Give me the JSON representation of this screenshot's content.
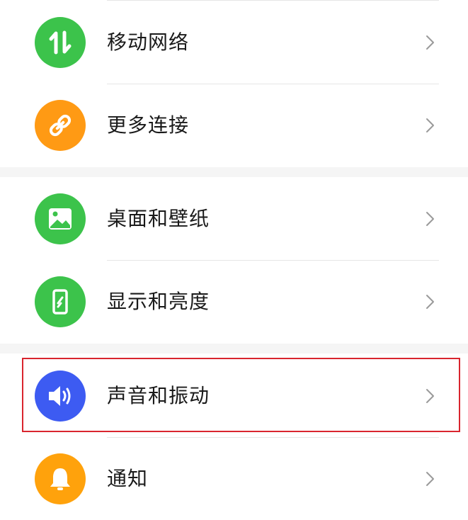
{
  "colors": {
    "green": "#3cc34b",
    "orange": "#ff9a14",
    "blue": "#3d5bf2",
    "amber": "#ffa20c",
    "highlight": "#d9252e"
  },
  "groups": [
    {
      "items": [
        {
          "label": "移动网络",
          "icon": "mobile-data-arrows-icon",
          "color": "#3cc34b"
        },
        {
          "label": "更多连接",
          "icon": "link-icon",
          "color": "#ff9a14"
        }
      ]
    },
    {
      "items": [
        {
          "label": "桌面和壁纸",
          "icon": "wallpaper-image-icon",
          "color": "#3cc34b"
        },
        {
          "label": "显示和亮度",
          "icon": "phone-display-icon",
          "color": "#3cc34b"
        }
      ]
    },
    {
      "items": [
        {
          "label": "声音和振动",
          "icon": "speaker-icon",
          "color": "#3d5bf2",
          "highlighted": true
        },
        {
          "label": "通知",
          "icon": "bell-icon",
          "color": "#ffa20c"
        }
      ]
    }
  ]
}
